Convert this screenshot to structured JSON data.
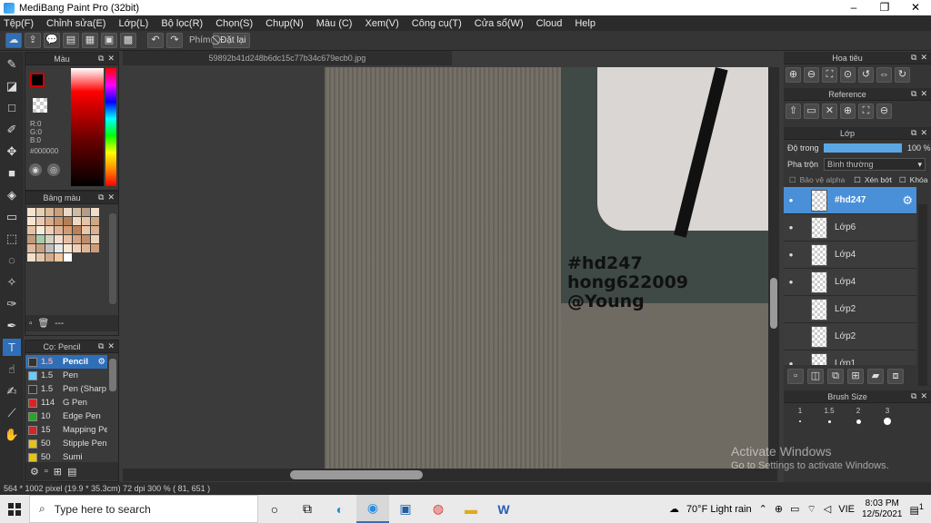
{
  "window": {
    "title": "MediBang Paint Pro (32bit)",
    "controls": [
      "–",
      "❐",
      "✕"
    ]
  },
  "menu": [
    "Tệp(F)",
    "Chỉnh sửa(E)",
    "Lớp(L)",
    "Bộ lọc(R)",
    "Chọn(S)",
    "Chụp(N)",
    "Màu (C)",
    "Xem(V)",
    "Công cụ(T)",
    "Cửa sổ(W)",
    "Cloud",
    "Help"
  ],
  "toolbar": {
    "key_label": "Phím",
    "reset_label": "Đặt lại"
  },
  "color_panel": {
    "title": "Màu",
    "rgb": [
      "R:0",
      "G:0",
      "B:0"
    ],
    "hex": "#000000",
    "primary": "#000000",
    "secondary": "#ffffff",
    "accent": "#cc0000"
  },
  "swatch_panel": {
    "title": "Bảng màu",
    "colors": [
      "#f6e3cc",
      "#e8cfb2",
      "#d9b896",
      "#c9a07a",
      "#ead7c4",
      "#d2bba4",
      "#b49d85",
      "#f1dcc6",
      "#f7e5d3",
      "#eccab0",
      "#d9ae8c",
      "#c6956d",
      "#b47e56",
      "#f2d8bf",
      "#e7c3a4",
      "#d0a884",
      "#e4c2a2",
      "#f8ead9",
      "#f1d0b6",
      "#e2b392",
      "#d19a73",
      "#bb8258",
      "#e9c7a8",
      "#dbb18e",
      "#c49a78",
      "#a7cba8",
      "#d2d2c0",
      "#f3dccd",
      "#e6c0a6",
      "#d4a485",
      "#c28d69",
      "#edd2bb",
      "#deba9b",
      "#c9a283",
      "#bfbfbf",
      "#e8e8e8",
      "#fbe6d4",
      "#efcfb5",
      "#e0b597",
      "#cf9c7a",
      "#f4dfcc",
      "#e6c6aa",
      "#d2ab8c",
      "#f0c8a0",
      "#ffffff"
    ]
  },
  "brush_panel": {
    "title": "Cọ: Pencil",
    "items": [
      {
        "size": "1.5",
        "name": "Pencil",
        "color": "#333333",
        "selected": true
      },
      {
        "size": "1.5",
        "name": "Pen",
        "color": "#66ccff"
      },
      {
        "size": "1.5",
        "name": "Pen (Sharp",
        "color": "#333333"
      },
      {
        "size": "114",
        "name": "G Pen",
        "color": "#dd2222"
      },
      {
        "size": "10",
        "name": "Edge Pen",
        "color": "#22aa22"
      },
      {
        "size": "15",
        "name": "Mapping Pe",
        "color": "#dd2222"
      },
      {
        "size": "50",
        "name": "Stipple Pen",
        "color": "#e5c21a"
      },
      {
        "size": "50",
        "name": "Sumi",
        "color": "#e5c21a"
      }
    ]
  },
  "document": {
    "tab": "59892b41d248b6dc15c77b34c679ecb0.jpg",
    "watermark_lines": [
      "#hd247",
      "hong622009",
      "@Young"
    ]
  },
  "navigator": {
    "title": "Hoa tiêu"
  },
  "reference": {
    "title": "Reference"
  },
  "layer_panel": {
    "title": "Lớp",
    "opacity_label": "Độ trong",
    "opacity_value": "100 %",
    "opacity": 1.0,
    "blend_label": "Pha trộn",
    "blend_value": "Bình thường",
    "protect_alpha": "Bảo vệ alpha",
    "clipping": "Xén bớt",
    "lock": "Khóa",
    "layers": [
      {
        "name": "#hd247",
        "selected": true,
        "visible": true
      },
      {
        "name": "Lớp6",
        "visible": true
      },
      {
        "name": "Lớp4",
        "visible": true
      },
      {
        "name": "Lớp4",
        "visible": true
      },
      {
        "name": "Lớp2",
        "visible": false
      },
      {
        "name": "Lớp2",
        "visible": false
      },
      {
        "name": "Lớp1",
        "visible": true
      }
    ]
  },
  "brush_size_panel": {
    "title": "Brush Size",
    "sizes": [
      "1",
      "1.5",
      "2",
      "3"
    ]
  },
  "status": {
    "text": "564 * 1002 pixel  (19.9 * 35.3cm)  72 dpi  300 %  ( 81, 651 )"
  },
  "activation": {
    "line1": "Activate Windows",
    "line2": "Go to Settings to activate Windows."
  },
  "taskbar": {
    "search_placeholder": "Type here to search",
    "weather": "70°F  Light rain",
    "language": "VIE",
    "time": "8:03 PM",
    "date": "12/5/2021",
    "notification_count": "1"
  }
}
